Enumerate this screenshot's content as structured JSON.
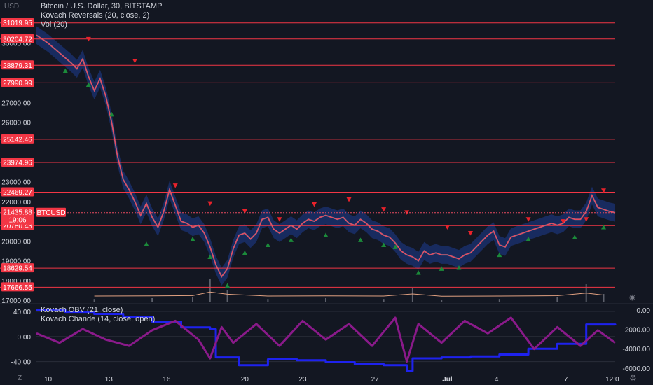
{
  "legend": {
    "symbol": "Bitcoin / U.S. Dollar, 30, BITSTAMP",
    "indicator": "Kovach Reversals (20, close, 2)",
    "volume": "Vol (20)",
    "osc1": "Kovach OBV (21, close)",
    "osc2": "Kovach Chande (14, close, open)"
  },
  "currency": "USD",
  "corner_icons": {
    "bottom_left": "Z",
    "settings": "gear-icon",
    "camera": "camera-icon"
  },
  "colors": {
    "background": "#131722",
    "level_line": "#f23645",
    "price_line": "#e84a5f",
    "band": "#2962ff",
    "obv": "#1e22ee",
    "chande": "#8a1a8a",
    "up_marker": "#1b8a3a",
    "down_marker": "#e8222b",
    "volume_ma": "#e0a080"
  },
  "chart_data": [
    {
      "type": "candlestick",
      "ylim": [
        16900,
        31400
      ],
      "y_ticks": [
        17000,
        18000,
        19000,
        20000,
        21000,
        22000,
        23000,
        26000,
        27000,
        30000
      ],
      "y_tick_labels": [
        "17000.00",
        "18000.00",
        "19000.00",
        "20000.00",
        "21000.00",
        "22000.00",
        "23000.00",
        "26000.00",
        "27000.00",
        "30000.00"
      ],
      "x_ticks": [
        "10",
        "13",
        "16",
        "20",
        "23",
        "27",
        "Jul",
        "4",
        "7",
        "12:0"
      ],
      "levels": [
        {
          "value": 31019.95,
          "label": "31019.95"
        },
        {
          "value": 30204.72,
          "label": "30204.72"
        },
        {
          "value": 28879.31,
          "label": "28879.31"
        },
        {
          "value": 27990.99,
          "label": "27990.99"
        },
        {
          "value": 25142.46,
          "label": "25142.46"
        },
        {
          "value": 23974.96,
          "label": "23974.96"
        },
        {
          "value": 22469.27,
          "label": "22469.27"
        },
        {
          "value": 20780.43,
          "label": "20780.43"
        },
        {
          "value": 18629.54,
          "label": "18629.54"
        },
        {
          "value": 17666.55,
          "label": "17666.55"
        }
      ],
      "current_price": {
        "value": 21435.88,
        "label": "21435.88",
        "countdown": "19:06",
        "symbol": "BTCUSD"
      },
      "price_path": [
        [
          0,
          30400
        ],
        [
          0.02,
          30000
        ],
        [
          0.04,
          29500
        ],
        [
          0.06,
          29000
        ],
        [
          0.07,
          28700
        ],
        [
          0.08,
          29200
        ],
        [
          0.09,
          28300
        ],
        [
          0.1,
          27600
        ],
        [
          0.11,
          28200
        ],
        [
          0.12,
          27300
        ],
        [
          0.13,
          26000
        ],
        [
          0.14,
          24300
        ],
        [
          0.15,
          23100
        ],
        [
          0.16,
          22600
        ],
        [
          0.17,
          22000
        ],
        [
          0.18,
          21300
        ],
        [
          0.19,
          21900
        ],
        [
          0.2,
          21200
        ],
        [
          0.21,
          20700
        ],
        [
          0.22,
          21500
        ],
        [
          0.23,
          22600
        ],
        [
          0.24,
          21800
        ],
        [
          0.25,
          21000
        ],
        [
          0.26,
          20900
        ],
        [
          0.27,
          20700
        ],
        [
          0.28,
          20800
        ],
        [
          0.29,
          20400
        ],
        [
          0.3,
          19700
        ],
        [
          0.31,
          18800
        ],
        [
          0.32,
          18200
        ],
        [
          0.33,
          18600
        ],
        [
          0.34,
          19600
        ],
        [
          0.35,
          20300
        ],
        [
          0.36,
          20400
        ],
        [
          0.37,
          20100
        ],
        [
          0.38,
          20400
        ],
        [
          0.39,
          21100
        ],
        [
          0.4,
          21200
        ],
        [
          0.41,
          20600
        ],
        [
          0.42,
          20400
        ],
        [
          0.43,
          20600
        ],
        [
          0.44,
          20800
        ],
        [
          0.45,
          20600
        ],
        [
          0.46,
          20900
        ],
        [
          0.47,
          21100
        ],
        [
          0.48,
          21000
        ],
        [
          0.49,
          21200
        ],
        [
          0.5,
          21300
        ],
        [
          0.51,
          21200
        ],
        [
          0.52,
          21100
        ],
        [
          0.53,
          21200
        ],
        [
          0.54,
          20900
        ],
        [
          0.55,
          20800
        ],
        [
          0.56,
          21100
        ],
        [
          0.57,
          20900
        ],
        [
          0.58,
          20600
        ],
        [
          0.59,
          20500
        ],
        [
          0.6,
          20300
        ],
        [
          0.61,
          20200
        ],
        [
          0.62,
          19900
        ],
        [
          0.63,
          19500
        ],
        [
          0.64,
          19300
        ],
        [
          0.65,
          19200
        ],
        [
          0.66,
          19000
        ],
        [
          0.67,
          19500
        ],
        [
          0.68,
          19300
        ],
        [
          0.69,
          19400
        ],
        [
          0.7,
          19300
        ],
        [
          0.71,
          19300
        ],
        [
          0.72,
          19200
        ],
        [
          0.73,
          19100
        ],
        [
          0.74,
          19300
        ],
        [
          0.75,
          19400
        ],
        [
          0.76,
          19700
        ],
        [
          0.77,
          20000
        ],
        [
          0.78,
          20300
        ],
        [
          0.79,
          20500
        ],
        [
          0.8,
          19800
        ],
        [
          0.81,
          19700
        ],
        [
          0.82,
          20200
        ],
        [
          0.83,
          20300
        ],
        [
          0.84,
          20400
        ],
        [
          0.85,
          20500
        ],
        [
          0.86,
          20600
        ],
        [
          0.87,
          20700
        ],
        [
          0.88,
          20800
        ],
        [
          0.89,
          20900
        ],
        [
          0.9,
          20800
        ],
        [
          0.91,
          20900
        ],
        [
          0.92,
          21200
        ],
        [
          0.93,
          21100
        ],
        [
          0.94,
          21100
        ],
        [
          0.95,
          21500
        ],
        [
          0.96,
          22300
        ],
        [
          0.97,
          21700
        ],
        [
          0.98,
          21600
        ],
        [
          0.99,
          21500
        ],
        [
          1,
          21436
        ]
      ],
      "markers_up": [
        [
          0.05,
          28600
        ],
        [
          0.09,
          27900
        ],
        [
          0.13,
          26400
        ],
        [
          0.19,
          19850
        ],
        [
          0.27,
          20100
        ],
        [
          0.3,
          19200
        ],
        [
          0.33,
          17750
        ],
        [
          0.36,
          19400
        ],
        [
          0.4,
          19800
        ],
        [
          0.44,
          20050
        ],
        [
          0.5,
          20300
        ],
        [
          0.56,
          20050
        ],
        [
          0.6,
          19800
        ],
        [
          0.62,
          19700
        ],
        [
          0.66,
          18400
        ],
        [
          0.7,
          18600
        ],
        [
          0.73,
          18650
        ],
        [
          0.8,
          19300
        ],
        [
          0.85,
          20100
        ],
        [
          0.93,
          20200
        ],
        [
          0.98,
          20700
        ]
      ],
      "markers_down": [
        [
          0.09,
          30200
        ],
        [
          0.17,
          29100
        ],
        [
          0.24,
          22800
        ],
        [
          0.3,
          21900
        ],
        [
          0.36,
          21500
        ],
        [
          0.42,
          21100
        ],
        [
          0.48,
          21850
        ],
        [
          0.54,
          22100
        ],
        [
          0.6,
          21600
        ],
        [
          0.64,
          21450
        ],
        [
          0.71,
          20700
        ],
        [
          0.75,
          20400
        ],
        [
          0.85,
          21100
        ],
        [
          0.91,
          21000
        ],
        [
          0.95,
          21100
        ],
        [
          0.98,
          22550
        ]
      ],
      "volume": [
        [
          0.1,
          0.12
        ],
        [
          0.2,
          0.15
        ],
        [
          0.27,
          0.2
        ],
        [
          0.3,
          0.85
        ],
        [
          0.33,
          0.45
        ],
        [
          0.4,
          0.12
        ],
        [
          0.5,
          0.15
        ],
        [
          0.6,
          0.12
        ],
        [
          0.65,
          0.5
        ],
        [
          0.7,
          0.1
        ],
        [
          0.8,
          0.12
        ],
        [
          0.9,
          0.18
        ],
        [
          0.95,
          0.65
        ],
        [
          0.98,
          0.3
        ]
      ]
    },
    {
      "type": "line",
      "y_ticks_left": [
        40,
        0,
        -40
      ],
      "y_tick_labels_left": [
        "40.00",
        "0.00",
        "-40.00"
      ],
      "y_ticks_right": [
        0,
        -2000,
        -4000,
        -6000
      ],
      "y_tick_labels_right": [
        "0.00",
        "-2000.00",
        "-4000.00",
        "-6000.00"
      ],
      "ylim_left": [
        -55,
        50
      ],
      "ylim_right": [
        -6300,
        500
      ],
      "series": [
        {
          "name": "Kovach OBV (21, close)",
          "axis": "right",
          "x": [
            0,
            0.05,
            0.1,
            0.15,
            0.2,
            0.25,
            0.3,
            0.31,
            0.35,
            0.4,
            0.45,
            0.5,
            0.55,
            0.6,
            0.64,
            0.65,
            0.7,
            0.75,
            0.8,
            0.85,
            0.9,
            0.95,
            1
          ],
          "values": [
            0,
            -200,
            -400,
            -700,
            -1200,
            -1800,
            -2000,
            -4900,
            -5700,
            -5100,
            -5200,
            -5400,
            -5600,
            -5700,
            -6300,
            -5000,
            -4900,
            -4800,
            -4600,
            -4000,
            -3500,
            -1500,
            -1600
          ]
        },
        {
          "name": "Kovach Chande (14, close, open)",
          "axis": "left",
          "x": [
            0,
            0.04,
            0.08,
            0.12,
            0.16,
            0.2,
            0.24,
            0.28,
            0.3,
            0.32,
            0.34,
            0.38,
            0.42,
            0.46,
            0.5,
            0.54,
            0.58,
            0.62,
            0.64,
            0.66,
            0.7,
            0.74,
            0.78,
            0.82,
            0.86,
            0.9,
            0.94,
            0.97,
            1
          ],
          "values": [
            5,
            -10,
            12,
            -5,
            -15,
            10,
            25,
            -5,
            -35,
            15,
            -10,
            20,
            -15,
            25,
            -5,
            20,
            -15,
            30,
            -40,
            20,
            -10,
            25,
            5,
            30,
            -20,
            15,
            -15,
            10,
            -10
          ]
        }
      ]
    }
  ]
}
